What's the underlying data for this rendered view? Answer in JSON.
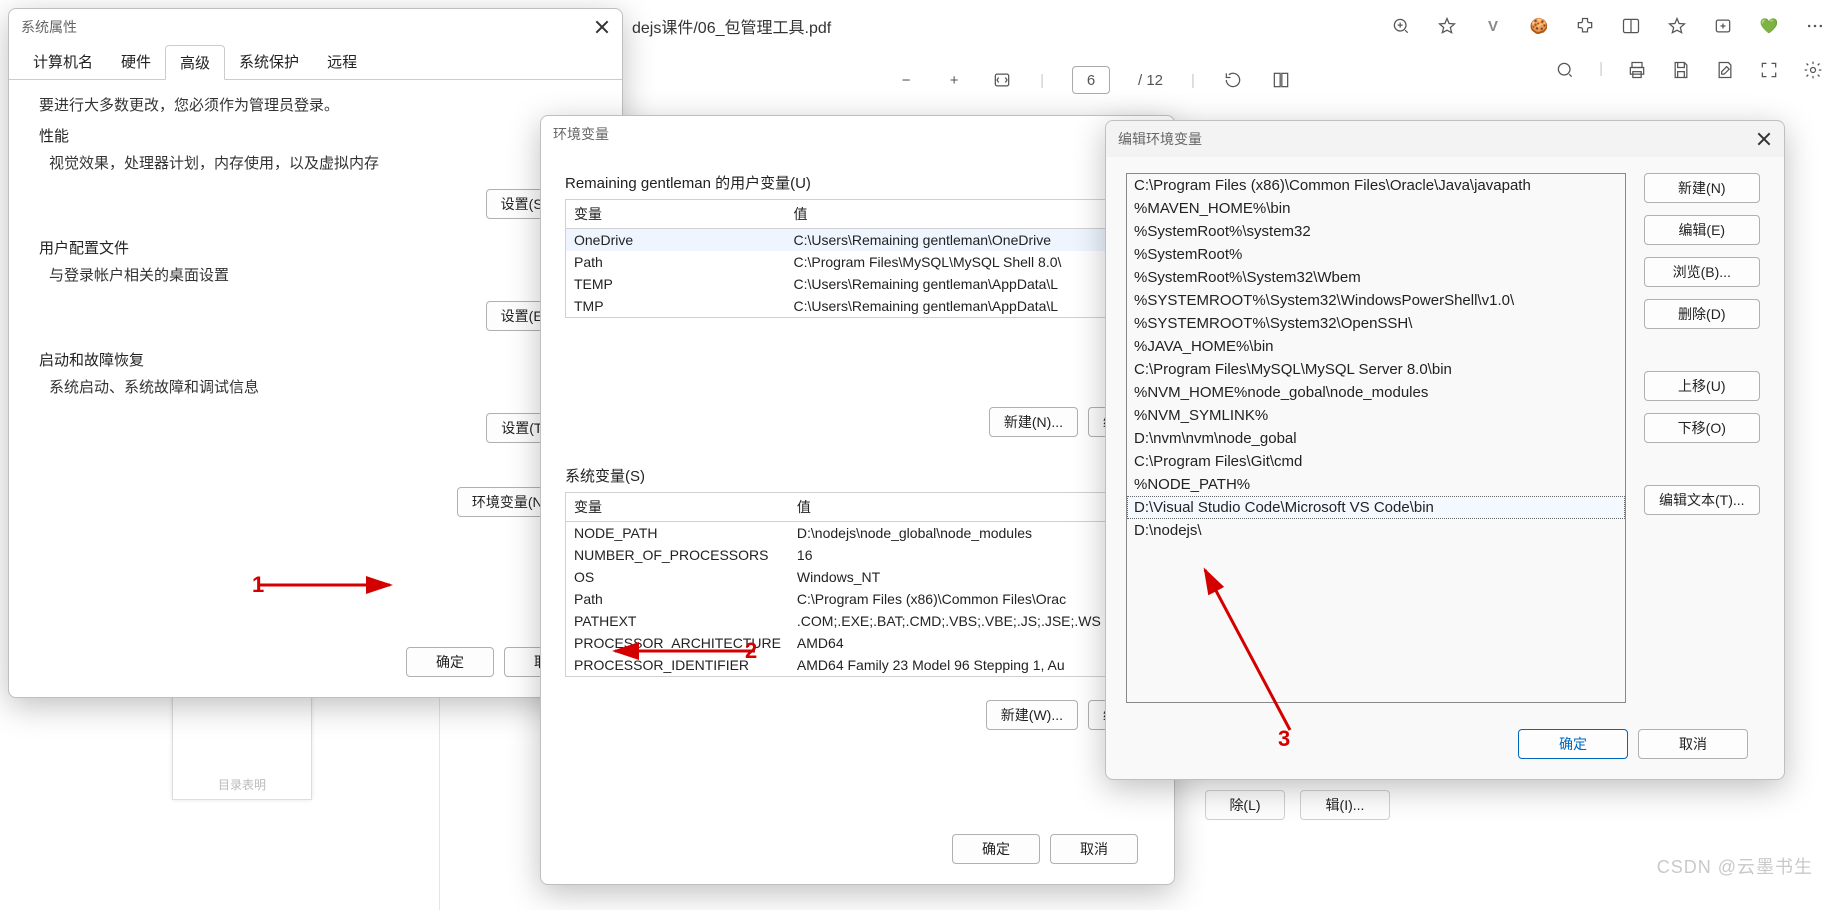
{
  "browser": {
    "address": "dejs课件/06_包管理工具.pdf",
    "page_current": "6",
    "page_total": "/ 12"
  },
  "sysprops": {
    "title": "系统属性",
    "tabs": [
      "计算机名",
      "硬件",
      "高级",
      "系统保护",
      "远程"
    ],
    "active_tab": 2,
    "admin_note": "要进行大多数更改，您必须作为管理员登录。",
    "sections": [
      {
        "heading": "性能",
        "desc": "视觉效果，处理器计划，内存使用，以及虚拟内存",
        "btn": "设置(S)..."
      },
      {
        "heading": "用户配置文件",
        "desc": "与登录帐户相关的桌面设置",
        "btn": "设置(E)..."
      },
      {
        "heading": "启动和故障恢复",
        "desc": "系统启动、系统故障和调试信息",
        "btn": "设置(T)..."
      }
    ],
    "env_btn": "环境变量(N)...",
    "ok": "确定",
    "cancel": "取消"
  },
  "envvars": {
    "title": "环境变量",
    "user_heading": "Remaining gentleman 的用户变量(U)",
    "col_var": "变量",
    "col_val": "值",
    "user_rows": [
      {
        "var": "OneDrive",
        "val": "C:\\Users\\Remaining gentleman\\OneDrive"
      },
      {
        "var": "Path",
        "val": "C:\\Program Files\\MySQL\\MySQL Shell 8.0\\"
      },
      {
        "var": "TEMP",
        "val": "C:\\Users\\Remaining gentleman\\AppData\\L"
      },
      {
        "var": "TMP",
        "val": "C:\\Users\\Remaining gentleman\\AppData\\L"
      }
    ],
    "sys_heading": "系统变量(S)",
    "sys_rows": [
      {
        "var": "NODE_PATH",
        "val": "D:\\nodejs\\node_global\\node_modules"
      },
      {
        "var": "NUMBER_OF_PROCESSORS",
        "val": "16"
      },
      {
        "var": "OS",
        "val": "Windows_NT"
      },
      {
        "var": "Path",
        "val": "C:\\Program Files (x86)\\Common Files\\Orac"
      },
      {
        "var": "PATHEXT",
        "val": ".COM;.EXE;.BAT;.CMD;.VBS;.VBE;.JS;.JSE;.WS"
      },
      {
        "var": "PROCESSOR_ARCHITECTURE",
        "val": "AMD64"
      },
      {
        "var": "PROCESSOR_IDENTIFIER",
        "val": "AMD64 Family 23 Model 96 Stepping 1, Au"
      }
    ],
    "new_u": "新建(N)...",
    "edit_u": "编",
    "new_s": "新建(W)...",
    "edit_s": "编",
    "ok": "确定",
    "cancel": "取消"
  },
  "editenv": {
    "title": "编辑环境变量",
    "rows": [
      "C:\\Program Files (x86)\\Common Files\\Oracle\\Java\\javapath",
      "%MAVEN_HOME%\\bin",
      "%SystemRoot%\\system32",
      "%SystemRoot%",
      "%SystemRoot%\\System32\\Wbem",
      "%SYSTEMROOT%\\System32\\WindowsPowerShell\\v1.0\\",
      "%SYSTEMROOT%\\System32\\OpenSSH\\",
      "%JAVA_HOME%\\bin",
      "C:\\Program Files\\MySQL\\MySQL Server 8.0\\bin",
      "%NVM_HOME%node_gobal\\node_modules",
      "%NVM_SYMLINK%",
      "D:\\nvm\\nvm\\node_gobal",
      "C:\\Program Files\\Git\\cmd",
      "%NODE_PATH%",
      "D:\\Visual Studio Code\\Microsoft VS Code\\bin",
      "D:\\nodejs\\"
    ],
    "selected": 14,
    "btns": {
      "new": "新建(N)",
      "edit": "编辑(E)",
      "browse": "浏览(B)...",
      "delete": "删除(D)",
      "up": "上移(U)",
      "down": "下移(O)",
      "edittext": "编辑文本(T)..."
    },
    "ok": "确定",
    "cancel": "取消"
  },
  "annotations": {
    "a1": "1",
    "a2": "2",
    "a3": "3"
  },
  "ghost": {
    "g1": "辑(I)...",
    "g2": "除(L)"
  },
  "watermark": "CSDN @云墨书生",
  "thumb_caption": "目录表明"
}
